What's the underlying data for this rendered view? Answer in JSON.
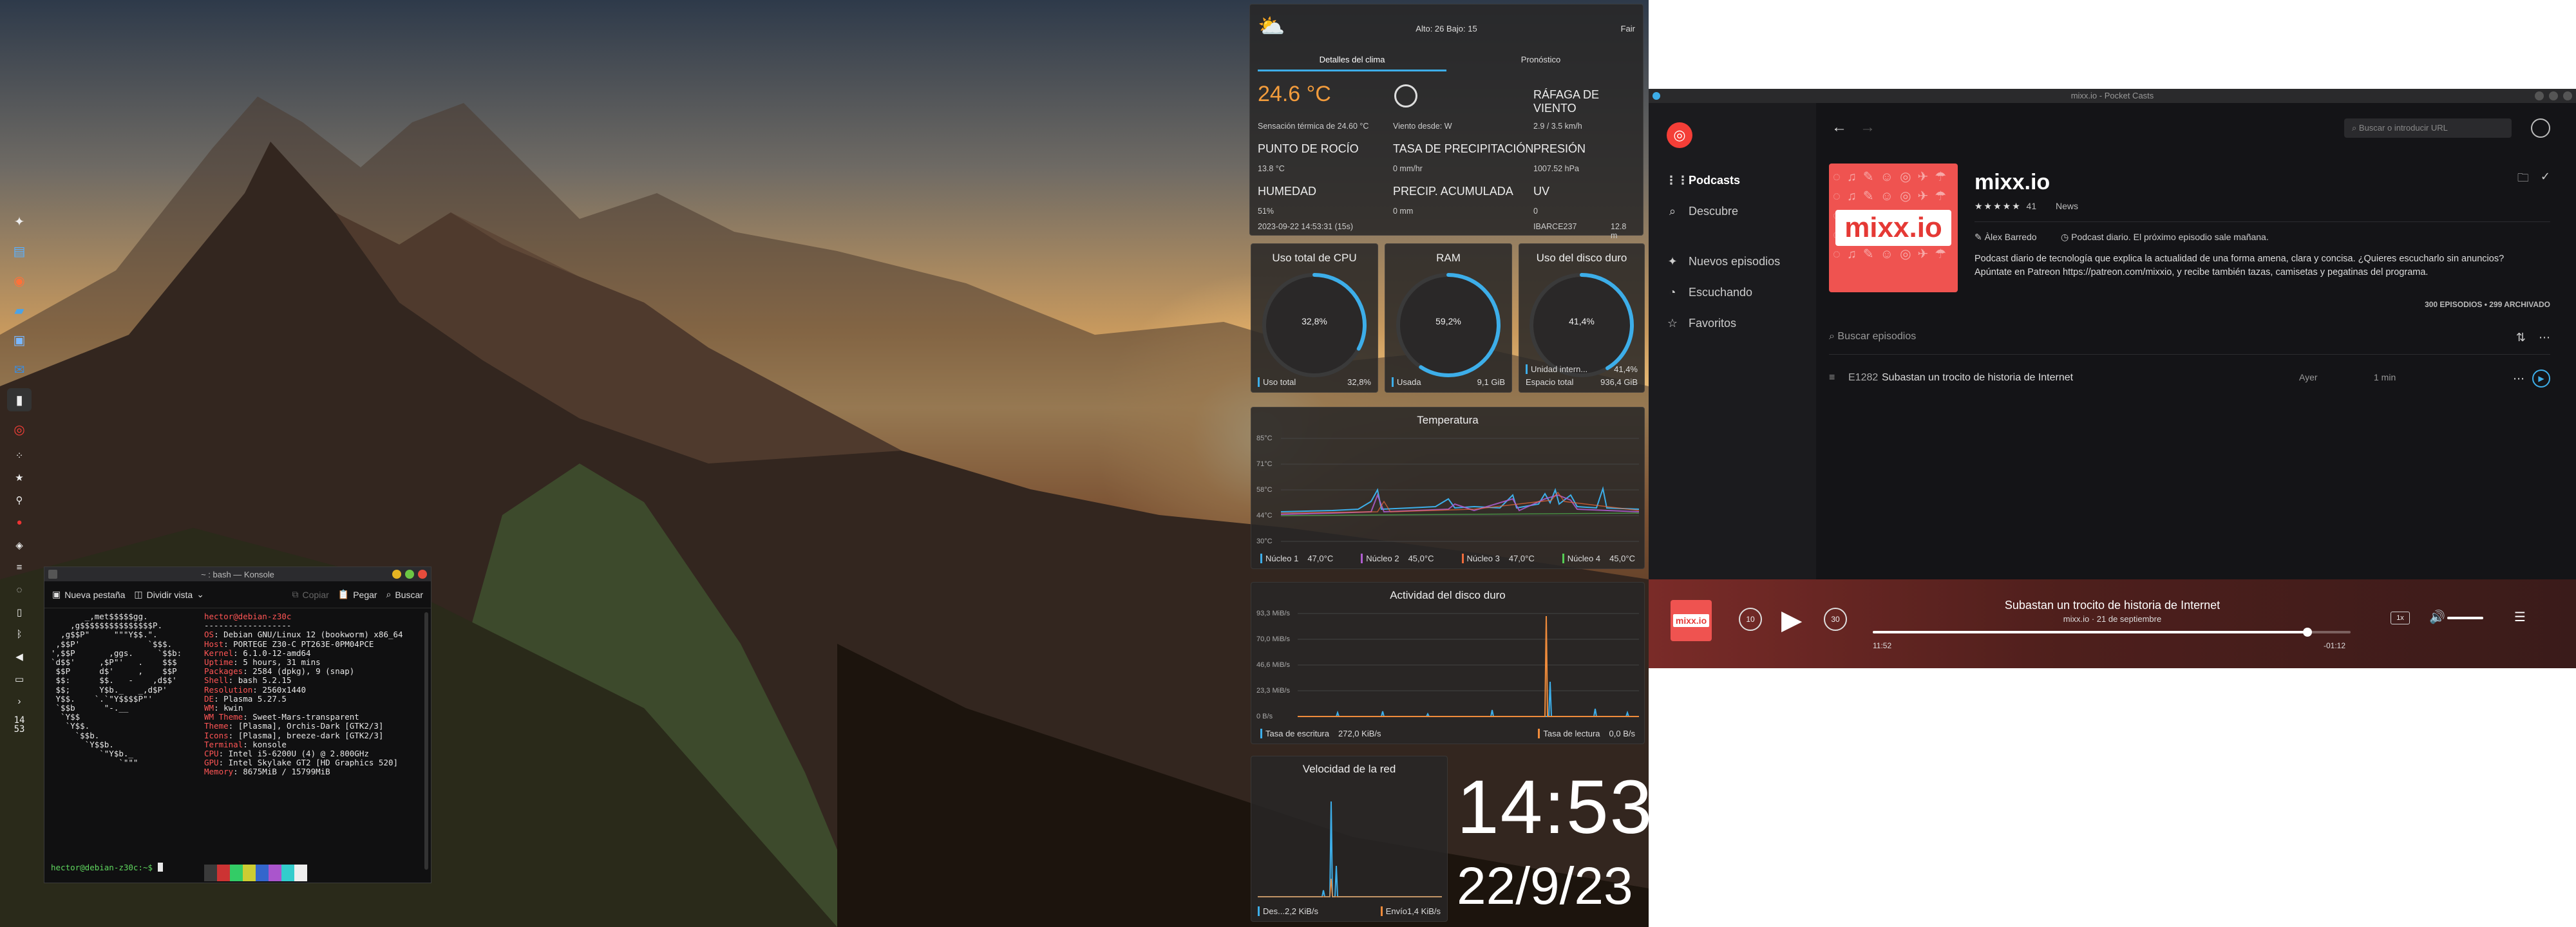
{
  "konsole": {
    "title": "~ : bash — Konsole",
    "toolbar": {
      "new_tab": "Nueva pestaña",
      "split_view": "Dividir vista",
      "copy": "Copiar",
      "paste": "Pegar",
      "search": "Buscar"
    },
    "logo_lines": [
      "       _,met$$$$$gg.",
      "    ,g$$$$$$$$$$$$$$$P.",
      "  ,g$$P\"     \"\"\"Y$$.\".",
      " ,$$P'              `$$$.",
      "',$$P       ,ggs.     `$$b:",
      "`d$$'     ,$P\"'   .    $$$",
      " $$P      d$'     ,    $$P",
      " $$:      $$.   -    ,d$$'",
      " $$;      Y$b._   _,d$P'",
      " Y$$.    `.`\"Y$$$$P\"'",
      " `$$b      \"-.__",
      "  `Y$$",
      "   `Y$$.",
      "     `$$b.",
      "       `Y$$b.",
      "          `\"Y$b._",
      "              `\"\"\""
    ],
    "user_host": "hector@debian-z30c",
    "separator": "------------------",
    "info": [
      {
        "k": "OS",
        "v": ": Debian GNU/Linux 12 (bookworm) x86_64"
      },
      {
        "k": "Host",
        "v": ": PORTEGE Z30-C PT263E-0PM04PCE"
      },
      {
        "k": "Kernel",
        "v": ": 6.1.0-12-amd64"
      },
      {
        "k": "Uptime",
        "v": ": 5 hours, 31 mins"
      },
      {
        "k": "Packages",
        "v": ": 2584 (dpkg), 9 (snap)"
      },
      {
        "k": "Shell",
        "v": ": bash 5.2.15"
      },
      {
        "k": "Resolution",
        "v": ": 2560x1440"
      },
      {
        "k": "DE",
        "v": ": Plasma 5.27.5"
      },
      {
        "k": "WM",
        "v": ": kwin"
      },
      {
        "k": "WM Theme",
        "v": ": Sweet-Mars-transparent"
      },
      {
        "k": "Theme",
        "v": ": [Plasma], Orchis-Dark [GTK2/3]"
      },
      {
        "k": "Icons",
        "v": ": [Plasma], breeze-dark [GTK2/3]"
      },
      {
        "k": "Terminal",
        "v": ": konsole"
      },
      {
        "k": "CPU",
        "v": ": Intel i5-6200U (4) @ 2.800GHz"
      },
      {
        "k": "GPU",
        "v": ": Intel Skylake GT2 [HD Graphics 520]"
      },
      {
        "k": "Memory",
        "v": ": 8675MiB / 15799MiB"
      }
    ],
    "palette": [
      "#3a3a3a",
      "#cc3333",
      "#33cc66",
      "#cccc33",
      "#3366cc",
      "#aa55cc",
      "#33cccc",
      "#eeeeee"
    ],
    "prompt": "hector@debian-z30c:~$ "
  },
  "dock": {
    "clock": [
      "14",
      "53"
    ]
  },
  "weather": {
    "hilo": "Alto: 26 Bajo: 15",
    "condition": "Fair",
    "tab_details": "Detalles del clima",
    "tab_forecast": "Pronóstico",
    "temp": "24.6 °C",
    "feels": "Sensación térmica de 24.60 °C",
    "gust_label": "RÁFAGA DE VIENTO",
    "wind_from": "Viento desde: W",
    "gust_val": "2.9 / 3.5 km/h",
    "dew_label": "PUNTO DE ROCÍO",
    "dew_val": "13.8 °C",
    "precip_rate_label": "TASA DE PRECIPITACIÓN",
    "precip_rate_val": "0 mm/hr",
    "pressure_label": "PRESIÓN",
    "pressure_val": "1007.52 hPa",
    "humidity_label": "HUMEDAD",
    "humidity_val": "51%",
    "precip_acc_label": "PRECIP. ACUMULADA",
    "precip_acc_val": "0 mm",
    "uv_label": "UV",
    "uv_val": "0",
    "timestamp": "2023-09-22 14:53:31 (15s)",
    "station": "IBARCE237",
    "distance": "12.8 m"
  },
  "cpu": {
    "title": "Uso total de CPU",
    "value": "32,8%",
    "fraction": 0.328,
    "legend_label": "Uso total",
    "legend_val": "32,8%"
  },
  "ram": {
    "title": "RAM",
    "value": "59,2%",
    "fraction": 0.592,
    "legend_label": "Usada",
    "legend_val": "9,1 GiB"
  },
  "disk": {
    "title": "Uso del disco duro",
    "value": "41,4%",
    "fraction": 0.414,
    "legend_label": "Unidad intern...",
    "legend_val": "41,4%",
    "legend2_label": "Espacio total",
    "legend2_val": "936,4 GiB"
  },
  "temps": {
    "title": "Temperatura",
    "ticks": [
      "85°C",
      "71°C",
      "58°C",
      "44°C",
      "30°C"
    ],
    "legend": [
      {
        "label": "Núcleo 1",
        "val": "47,0°C",
        "color": "#3daee9"
      },
      {
        "label": "Núcleo 2",
        "val": "45,0°C",
        "color": "#b05ed0"
      },
      {
        "label": "Núcleo 3",
        "val": "47,0°C",
        "color": "#ef6b3b"
      },
      {
        "label": "Núcleo 4",
        "val": "45,0°C",
        "color": "#55cc55"
      }
    ]
  },
  "diskact": {
    "title": "Actividad del disco duro",
    "ticks": [
      "93,3 MiB/s",
      "70,0 MiB/s",
      "46,6 MiB/s",
      "23,3 MiB/s",
      "0 B/s"
    ],
    "legend": [
      {
        "label": "Tasa de escritura",
        "val": "272,0 KiB/s",
        "color": "#3daee9"
      },
      {
        "label": "Tasa de lectura",
        "val": "0,0 B/s",
        "color": "#ef8b3b"
      }
    ]
  },
  "net": {
    "title": "Velocidad de la red",
    "legend": [
      {
        "label": "Des...",
        "val": "2,2 KiB/s",
        "color": "#3daee9"
      },
      {
        "label": "Envío",
        "val": "1,4 KiB/s",
        "color": "#ef8b3b"
      }
    ]
  },
  "clock": {
    "time": "14:53",
    "date": "22/9/23"
  },
  "pocketcasts": {
    "window_title": "mixx.io - Pocket Casts",
    "nav": [
      "Podcasts",
      "Descubre",
      "Nuevos episodios",
      "Escuchando",
      "Favoritos"
    ],
    "search_placeholder": "Buscar o introducir URL",
    "art_brand": "mixx.io",
    "podcast_title": "mixx.io",
    "stars": "★★★★★",
    "rating_count": "41",
    "category": "News",
    "author": "Àlex Barredo",
    "schedule": "Podcast diario. El próximo episodio sale mañana.",
    "description": "Podcast diario de tecnología que explica la actualidad de una forma amena, clara y concisa. ¿Quieres escucharlo sin anuncios? Apúntate en Patreon https://patreon.com/mixxio, y recibe también tazas, camisetas y pegatinas del programa.",
    "counts": "300 EPISODIOS • 299 ARCHIVADO",
    "search_episodes": "Buscar episodios",
    "episode": {
      "number": "E1282",
      "title": "Subastan un trocito de historia de Internet",
      "when": "Ayer",
      "duration": "1 min"
    },
    "player": {
      "title": "Subastan un trocito de historia de Internet",
      "subtitle": "mixx.io · 21 de septiembre",
      "elapsed": "11:52",
      "remaining": "-01:12",
      "progress": 0.91,
      "skip_back": "10",
      "skip_fwd": "30",
      "speed": "1x",
      "thumb_brand": "mixx.io"
    }
  }
}
